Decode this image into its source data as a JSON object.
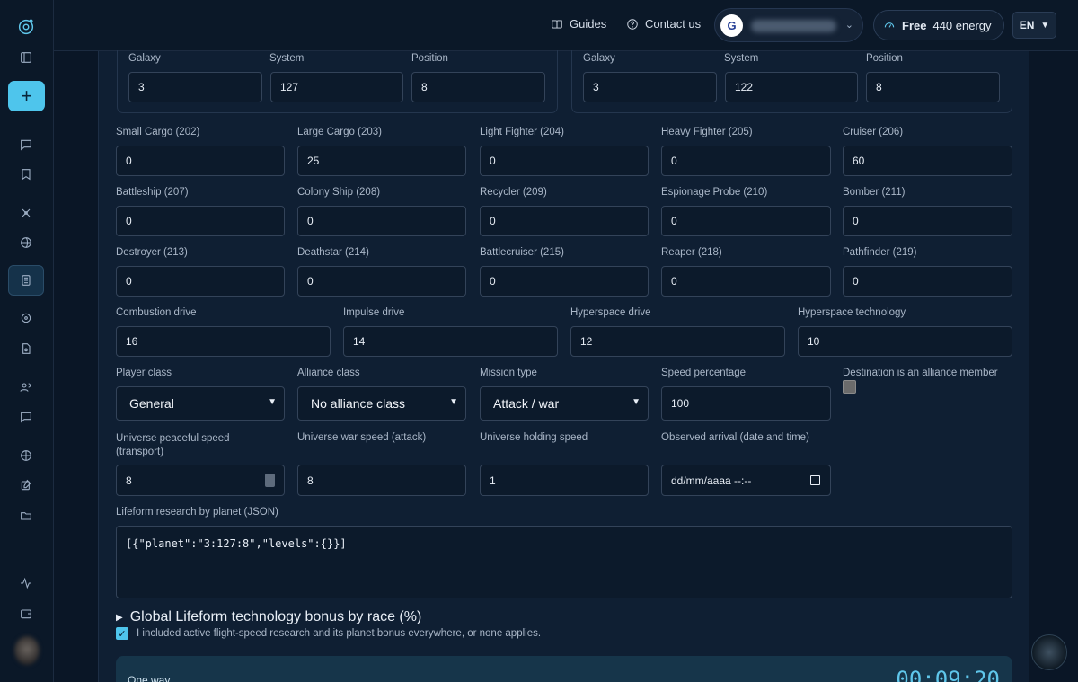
{
  "topbar": {
    "guides_label": "Guides",
    "contact_label": "Contact us",
    "user_initial": "G",
    "energy_tier": "Free",
    "energy_amount": "440 energy",
    "language": "EN"
  },
  "origin": {
    "galaxy_label": "Galaxy",
    "galaxy_value": "3",
    "system_label": "System",
    "system_value": "127",
    "position_label": "Position",
    "position_value": "8"
  },
  "destination": {
    "galaxy_label": "Galaxy",
    "galaxy_value": "3",
    "system_label": "System",
    "system_value": "122",
    "position_label": "Position",
    "position_value": "8"
  },
  "ships": [
    {
      "label": "Small Cargo (202)",
      "value": "0"
    },
    {
      "label": "Large Cargo (203)",
      "value": "25"
    },
    {
      "label": "Light Fighter (204)",
      "value": "0"
    },
    {
      "label": "Heavy Fighter (205)",
      "value": "0"
    },
    {
      "label": "Cruiser (206)",
      "value": "60"
    },
    {
      "label": "Battleship (207)",
      "value": "0"
    },
    {
      "label": "Colony Ship (208)",
      "value": "0"
    },
    {
      "label": "Recycler (209)",
      "value": "0"
    },
    {
      "label": "Espionage Probe (210)",
      "value": "0"
    },
    {
      "label": "Bomber (211)",
      "value": "0"
    },
    {
      "label": "Destroyer (213)",
      "value": "0"
    },
    {
      "label": "Deathstar (214)",
      "value": "0"
    },
    {
      "label": "Battlecruiser (215)",
      "value": "0"
    },
    {
      "label": "Reaper (218)",
      "value": "0"
    },
    {
      "label": "Pathfinder (219)",
      "value": "0"
    }
  ],
  "drives": [
    {
      "label": "Combustion drive",
      "value": "16"
    },
    {
      "label": "Impulse drive",
      "value": "14"
    },
    {
      "label": "Hyperspace drive",
      "value": "12"
    },
    {
      "label": "Hyperspace technology",
      "value": "10"
    }
  ],
  "settings": {
    "player_class_label": "Player class",
    "player_class_value": "General",
    "alliance_class_label": "Alliance class",
    "alliance_class_value": "No alliance class",
    "mission_type_label": "Mission type",
    "mission_type_value": "Attack / war",
    "speed_pct_label": "Speed percentage",
    "speed_pct_value": "100",
    "alliance_member_label": "Destination is an alliance member"
  },
  "universe": {
    "peaceful_label": "Universe peaceful speed (transport)",
    "peaceful_value": "8",
    "war_label": "Universe war speed (attack)",
    "war_value": "8",
    "holding_label": "Universe holding speed",
    "holding_value": "1",
    "arrival_label": "Observed arrival (date and time)",
    "arrival_placeholder": "dd/mm/aaaa --:--"
  },
  "lifeform": {
    "label": "Lifeform research by planet (JSON)",
    "value": "[{\"planet\":\"3:127:8\",\"levels\":{}}]",
    "bonus_summary": "Global Lifeform technology bonus by race (%)",
    "confirm_text": "I included active flight-speed research and its planet bonus everywhere, or none applies."
  },
  "result": {
    "label": "One way",
    "time": "00:09:20"
  }
}
